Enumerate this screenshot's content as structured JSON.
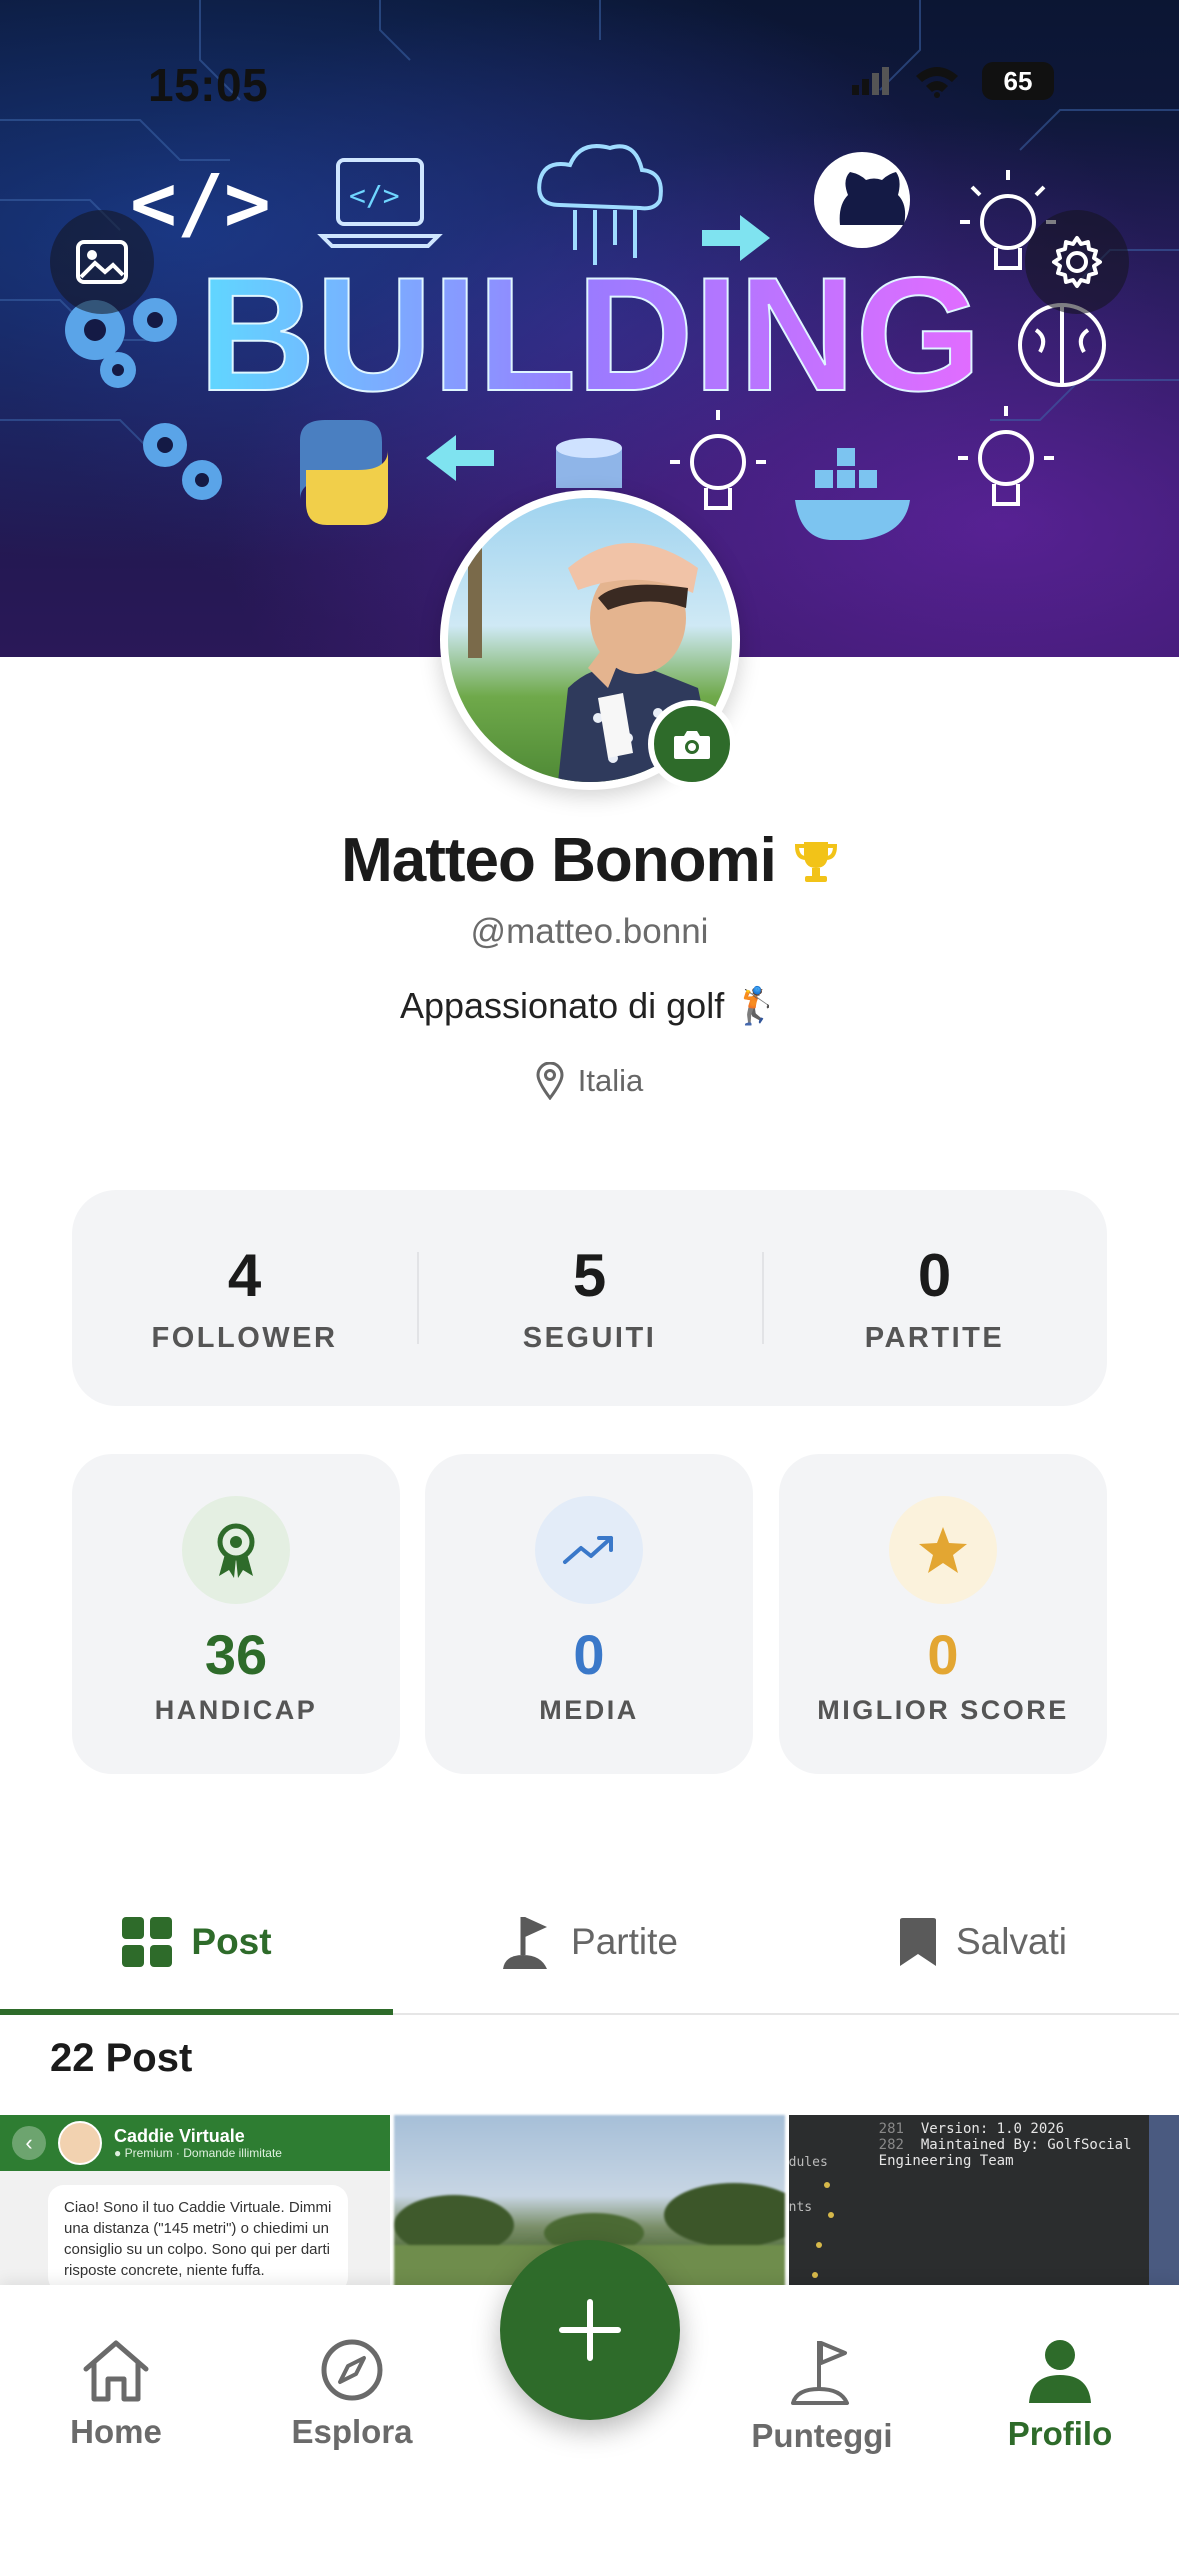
{
  "status_bar": {
    "time": "15:05",
    "battery": "65"
  },
  "cover": {
    "headline": "BUILDING",
    "code_tag": "</>",
    "mini_code_tag": "</>"
  },
  "profile": {
    "name": "Matteo Bonomi",
    "handle": "@matteo.bonni",
    "bio": "Appassionato di golf 🏌",
    "location": "Italia"
  },
  "counts": [
    {
      "value": "4",
      "label": "FOLLOWER"
    },
    {
      "value": "5",
      "label": "SEGUITI"
    },
    {
      "value": "0",
      "label": "PARTITE"
    }
  ],
  "stats": [
    {
      "value": "36",
      "label": "HANDICAP",
      "color": "#2e6b2a",
      "icon": "ribbon-icon"
    },
    {
      "value": "0",
      "label": "MEDIA",
      "color": "#3a78c9",
      "icon": "trending-up-icon"
    },
    {
      "value": "0",
      "label": "MIGLIOR SCORE",
      "color": "#e3a632",
      "icon": "star-icon"
    }
  ],
  "tabs": [
    {
      "label": "Post",
      "icon": "grid-icon",
      "active": true
    },
    {
      "label": "Partite",
      "icon": "flag-icon",
      "active": false
    },
    {
      "label": "Salvati",
      "icon": "bookmark-icon",
      "active": false
    }
  ],
  "posts_header": "22 Post",
  "post_tiles": {
    "caddie_title": "Caddie Virtuale",
    "caddie_subtitle": "● Premium · Domande illimitate",
    "caddie_message": "Ciao! Sono il tuo Caddie Virtuale. Dimmi una distanza (\"145 metri\") o chiedimi un consiglio su un colpo. Sono qui per darti risposte concrete, niente fuffa.",
    "code_line1": "Version: 1.0 2026",
    "code_line2": "Maintained By: GolfSocial Engineering Team",
    "code_num1": "281",
    "code_num2": "282",
    "code_side1": "dules",
    "code_side2": "nts"
  },
  "nav": [
    {
      "label": "Home",
      "icon": "home-icon",
      "active": false
    },
    {
      "label": "Esplora",
      "icon": "compass-icon",
      "active": false
    },
    {
      "label": "Punteggi",
      "icon": "flag-icon",
      "active": false
    },
    {
      "label": "Profilo",
      "icon": "person-icon",
      "active": true
    }
  ],
  "colors": {
    "brand_green": "#2e6b2a",
    "blue": "#3a78c9",
    "gold": "#e3a632",
    "card_bg": "#f3f4f6"
  }
}
